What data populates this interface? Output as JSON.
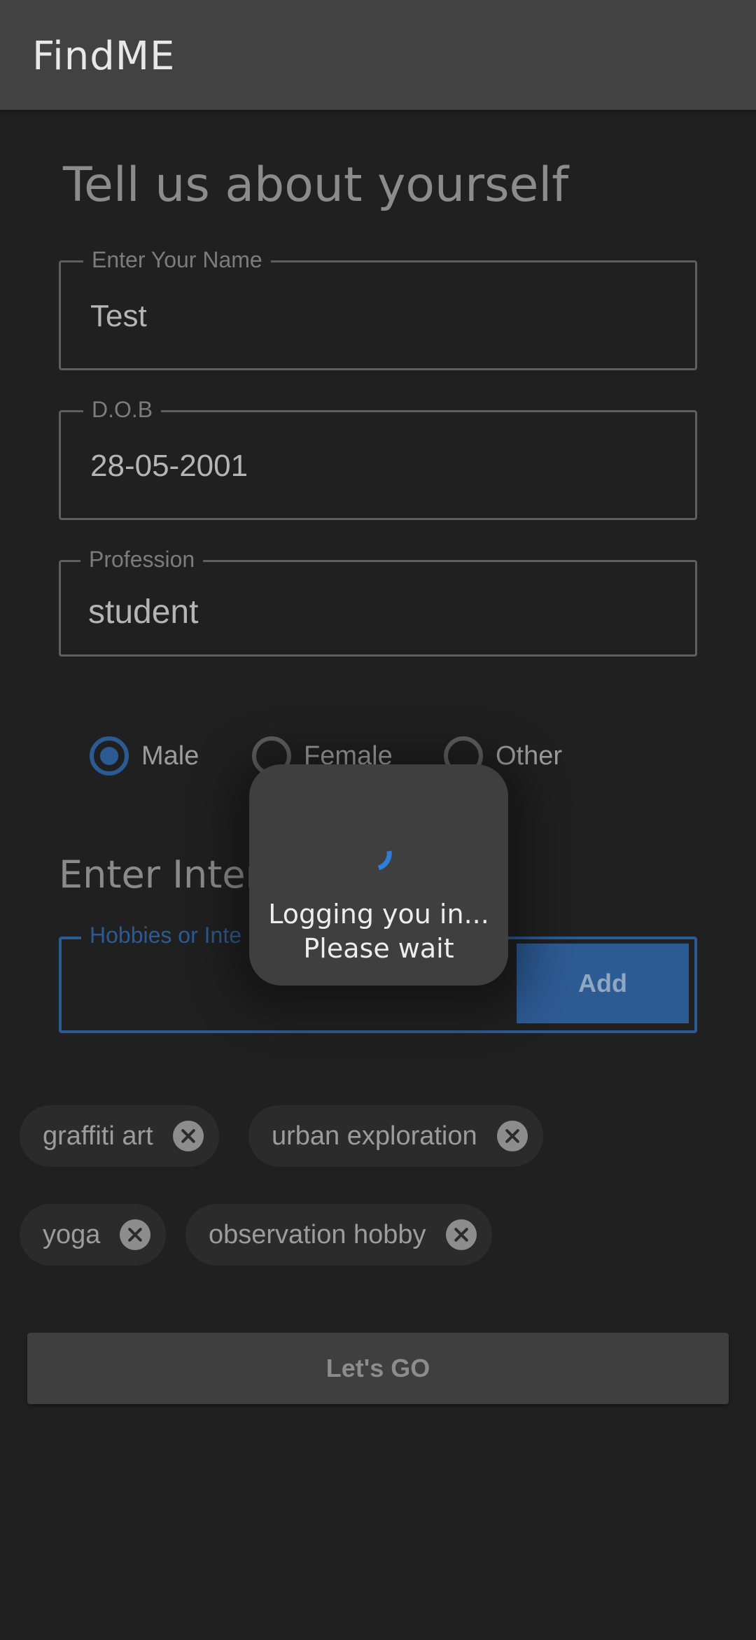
{
  "app_bar": {
    "title": "FindME"
  },
  "form": {
    "heading": "Tell us about yourself",
    "name": {
      "label": "Enter Your Name",
      "value": "Test"
    },
    "dob": {
      "label": "D.O.B",
      "value": "28-05-2001"
    },
    "profession": {
      "label": "Profession",
      "value": "student"
    },
    "gender": {
      "options": [
        "Male",
        "Female",
        "Other"
      ],
      "selected": "Male"
    }
  },
  "interests": {
    "section_title": "Enter Inter",
    "input_label": "Hobbies or Inte",
    "input_value": "",
    "add_label": "Add",
    "chips": [
      "graffiti art",
      "urban exploration",
      "yoga",
      "observation hobby"
    ]
  },
  "submit_label": "Let's GO",
  "loading_dialog": {
    "line1": "Logging you in...",
    "line2": "Please wait"
  },
  "colors": {
    "accent": "#2c5a92",
    "spinner": "#2f7fd8",
    "background": "#202020",
    "app_bar": "#424242"
  }
}
